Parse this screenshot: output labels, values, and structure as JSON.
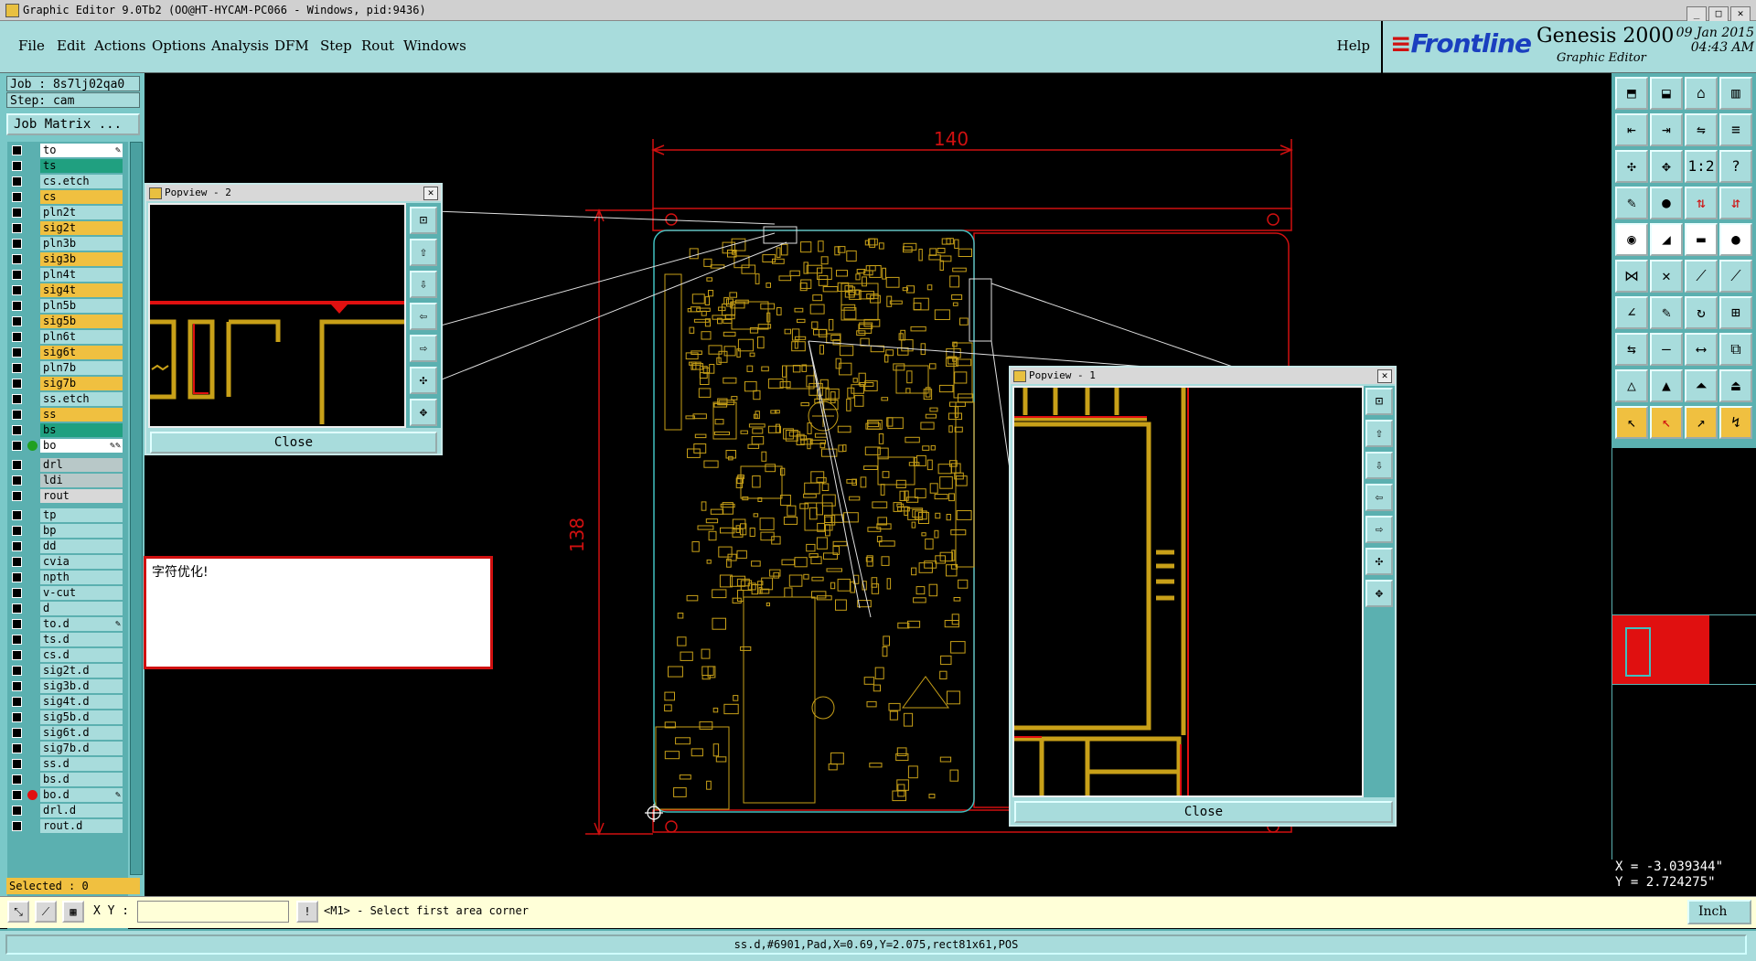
{
  "window": {
    "title": "Graphic Editor 9.0Tb2 (OO@HT-HYCAM-PC066 - Windows, pid:9436)"
  },
  "menu": [
    "File",
    "Edit",
    "Actions",
    "Options",
    "Analysis",
    "DFM",
    "Step",
    "Rout",
    "Windows"
  ],
  "help_label": "Help",
  "brand": {
    "logo": "Frontline",
    "product": "Genesis 2000",
    "subtitle": "Graphic Editor",
    "date": "09 Jan 2015",
    "time": "04:43 AM"
  },
  "job": {
    "job_line": "Job : 8s7lj02qa0",
    "step_line": "Step: cam",
    "matrix_button": "Job Matrix ..."
  },
  "layers": [
    {
      "name": "to",
      "color": "#ffffff",
      "flag": "✎"
    },
    {
      "name": "ts",
      "color": "#20a080"
    },
    {
      "name": "cs.etch",
      "color": "#a8dcdc"
    },
    {
      "name": "cs",
      "color": "#f0c040"
    },
    {
      "name": "pln2t",
      "color": "#a8dcdc"
    },
    {
      "name": "sig2t",
      "color": "#f0c040"
    },
    {
      "name": "pln3b",
      "color": "#a8dcdc"
    },
    {
      "name": "sig3b",
      "color": "#f0c040"
    },
    {
      "name": "pln4t",
      "color": "#a8dcdc"
    },
    {
      "name": "sig4t",
      "color": "#f0c040"
    },
    {
      "name": "pln5b",
      "color": "#a8dcdc"
    },
    {
      "name": "sig5b",
      "color": "#f0c040"
    },
    {
      "name": "pln6t",
      "color": "#a8dcdc"
    },
    {
      "name": "sig6t",
      "color": "#f0c040"
    },
    {
      "name": "pln7b",
      "color": "#a8dcdc"
    },
    {
      "name": "sig7b",
      "color": "#f0c040"
    },
    {
      "name": "ss.etch",
      "color": "#a8dcdc"
    },
    {
      "name": "ss",
      "color": "#f0c040"
    },
    {
      "name": "bs",
      "color": "#20a080"
    },
    {
      "name": "bo",
      "color": "#ffffff",
      "flag": "✎✎",
      "dot": "#20a020"
    },
    {
      "name": "drl",
      "color": "#b8c8c8"
    },
    {
      "name": "ldi",
      "color": "#b8c8c8"
    },
    {
      "name": "rout",
      "color": "#d8d8d8"
    },
    {
      "name": "tp",
      "color": "#a8dcdc"
    },
    {
      "name": "bp",
      "color": "#a8dcdc"
    },
    {
      "name": "dd",
      "color": "#a8dcdc"
    },
    {
      "name": "cvia",
      "color": "#a8dcdc"
    },
    {
      "name": "npth",
      "color": "#a8dcdc"
    },
    {
      "name": "v-cut",
      "color": "#a8dcdc"
    },
    {
      "name": "d",
      "color": "#a8dcdc"
    },
    {
      "name": "to.d",
      "color": "#a8dcdc",
      "flag": "✎"
    },
    {
      "name": "ts.d",
      "color": "#a8dcdc"
    },
    {
      "name": "cs.d",
      "color": "#a8dcdc"
    },
    {
      "name": "sig2t.d",
      "color": "#a8dcdc"
    },
    {
      "name": "sig3b.d",
      "color": "#a8dcdc"
    },
    {
      "name": "sig4t.d",
      "color": "#a8dcdc"
    },
    {
      "name": "sig5b.d",
      "color": "#a8dcdc"
    },
    {
      "name": "sig6t.d",
      "color": "#a8dcdc"
    },
    {
      "name": "sig7b.d",
      "color": "#a8dcdc"
    },
    {
      "name": "ss.d",
      "color": "#a8dcdc"
    },
    {
      "name": "bs.d",
      "color": "#a8dcdc"
    },
    {
      "name": "bo.d",
      "color": "#a8dcdc",
      "flag": "✎",
      "dot": "#e01010"
    },
    {
      "name": "drl.d",
      "color": "#a8dcdc"
    },
    {
      "name": "rout.d",
      "color": "#a8dcdc"
    }
  ],
  "selected_label": "Selected : 0",
  "dimensions": {
    "width": "140",
    "height": "138"
  },
  "popview2": {
    "title": "Popview - 2",
    "close": "Close"
  },
  "popview1": {
    "title": "Popview - 1",
    "close": "Close"
  },
  "message": "字符优化!",
  "coords": {
    "x": "X = -3.039344\"",
    "y": "Y =  2.724275\""
  },
  "cmd": {
    "xy_label": "X Y :",
    "input_value": "",
    "message": "<M1> - Select first area corner",
    "unit": "Inch"
  },
  "status": "ss.d,#6901,Pad,X=0.69,Y=2.075,rect81x61,POS",
  "colors": {
    "accent": "#a8dcdc",
    "highlight": "#f0c040",
    "copper": "#c8a018",
    "dim_red": "#d01010"
  }
}
